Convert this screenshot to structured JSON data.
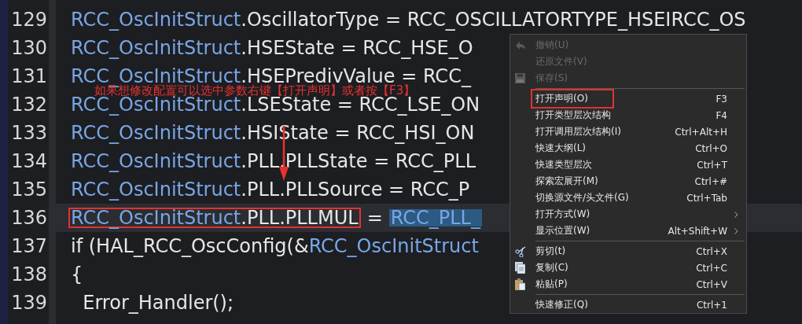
{
  "code_lines": [
    {
      "number": "129",
      "current": false,
      "runs": [
        {
          "kind": "text",
          "parts": [
            {
              "kind": "identifier",
              "text": "RCC_OscInitStruct"
            },
            {
              "kind": "plain",
              "text": ".OscillatorType = RCC_OSCILLATORTYPE_HSEIRCC_OS"
            }
          ]
        }
      ]
    },
    {
      "number": "130",
      "current": false,
      "runs": [
        {
          "kind": "text",
          "parts": [
            {
              "kind": "identifier",
              "text": "RCC_OscInitStruct"
            },
            {
              "kind": "plain",
              "text": ".HSEState = RCC_HSE_O"
            }
          ]
        }
      ]
    },
    {
      "number": "131",
      "current": false,
      "runs": [
        {
          "kind": "text",
          "parts": [
            {
              "kind": "identifier",
              "text": "RCC_OscInitStruct"
            },
            {
              "kind": "plain",
              "text": ".HSEPredivValue = RCC_"
            }
          ]
        }
      ]
    },
    {
      "number": "132",
      "current": false,
      "runs": [
        {
          "kind": "text",
          "parts": [
            {
              "kind": "identifier",
              "text": "RCC_OscInitStruct"
            },
            {
              "kind": "plain",
              "text": ".LSEState = RCC_LSE_ON"
            }
          ]
        }
      ]
    },
    {
      "number": "133",
      "current": false,
      "runs": [
        {
          "kind": "text",
          "parts": [
            {
              "kind": "identifier",
              "text": "RCC_OscInitStruct"
            },
            {
              "kind": "plain",
              "text": ".HSIState = RCC_HSI_ON"
            }
          ]
        }
      ]
    },
    {
      "number": "134",
      "current": false,
      "runs": [
        {
          "kind": "text",
          "parts": [
            {
              "kind": "identifier",
              "text": "RCC_OscInitStruct"
            },
            {
              "kind": "plain",
              "text": ".PLL.PLLState = RCC_PLL"
            }
          ]
        }
      ]
    },
    {
      "number": "135",
      "current": false,
      "runs": [
        {
          "kind": "text",
          "parts": [
            {
              "kind": "identifier",
              "text": "RCC_OscInitStruct"
            },
            {
              "kind": "plain",
              "text": ".PLL.PLLSource = RCC_P"
            }
          ]
        }
      ]
    },
    {
      "number": "136",
      "current": true,
      "runs": [
        {
          "kind": "box",
          "parts": [
            {
              "kind": "identifier",
              "text": "RCC_OscInitStruct"
            },
            {
              "kind": "plain",
              "text": ".PLL.PLLMUL"
            }
          ]
        },
        {
          "kind": "text",
          "parts": [
            {
              "kind": "plain",
              "text": "="
            }
          ]
        },
        {
          "kind": "selection",
          "parts": [
            {
              "kind": "identifier",
              "text": "RCC_PLL_"
            }
          ]
        }
      ]
    },
    {
      "number": "137",
      "current": false,
      "runs": [
        {
          "kind": "text",
          "parts": [
            {
              "kind": "plain",
              "text": "if (HAL_RCC_OscConfig(&"
            },
            {
              "kind": "identifier",
              "text": "RCC_OscInitStruct"
            }
          ]
        }
      ]
    },
    {
      "number": "138",
      "current": false,
      "runs": [
        {
          "kind": "text",
          "parts": [
            {
              "kind": "plain",
              "text": "{"
            }
          ]
        }
      ]
    },
    {
      "number": "139",
      "current": false,
      "runs": [
        {
          "kind": "text",
          "parts": [
            {
              "kind": "plain",
              "text": "  Error_Handler();"
            }
          ]
        }
      ]
    }
  ],
  "annotation": {
    "text": "如果想修改配置可以选中参数右键【打开声明】或者按【F3】"
  },
  "context_menu": {
    "items": [
      {
        "kind": "item",
        "label": "撤销(U)",
        "disabled": true
      },
      {
        "kind": "item",
        "label": "还原文件(V)",
        "disabled": true
      },
      {
        "kind": "item",
        "label": "保存(S)",
        "disabled": true
      },
      {
        "kind": "separator"
      },
      {
        "kind": "item",
        "label": "打开声明(O)",
        "shortcut": "F3",
        "disabled": false,
        "annotated": true
      },
      {
        "kind": "item",
        "label": "打开类型层次结构",
        "shortcut": "F4",
        "disabled": false
      },
      {
        "kind": "item",
        "label": "打开调用层次结构(I)",
        "shortcut": "Ctrl+Alt+H",
        "disabled": false
      },
      {
        "kind": "item",
        "label": "快速大纲(L)",
        "shortcut": "Ctrl+O",
        "disabled": false
      },
      {
        "kind": "item",
        "label": "快速类型层次",
        "shortcut": "Ctrl+T",
        "disabled": false
      },
      {
        "kind": "item",
        "label": "探索宏展开(M)",
        "shortcut": "Ctrl+#",
        "disabled": false
      },
      {
        "kind": "item",
        "label": "切换源文件/头文件(G)",
        "shortcut": "Ctrl+Tab",
        "disabled": false
      },
      {
        "kind": "item",
        "label": "打开方式(W)",
        "disabled": false,
        "submenu": true
      },
      {
        "kind": "item",
        "label": "显示位置(W)",
        "shortcut": "Alt+Shift+W",
        "disabled": false,
        "submenu": true
      },
      {
        "kind": "separator"
      },
      {
        "kind": "item",
        "label": "剪切(t)",
        "shortcut": "Ctrl+X",
        "disabled": false
      },
      {
        "kind": "item",
        "label": "复制(C)",
        "shortcut": "Ctrl+C",
        "disabled": false
      },
      {
        "kind": "item",
        "label": "粘贴(P)",
        "shortcut": "Ctrl+V",
        "disabled": false
      },
      {
        "kind": "separator"
      },
      {
        "kind": "item",
        "label": "快速修正(Q)",
        "shortcut": "Ctrl+1",
        "disabled": false
      }
    ]
  }
}
